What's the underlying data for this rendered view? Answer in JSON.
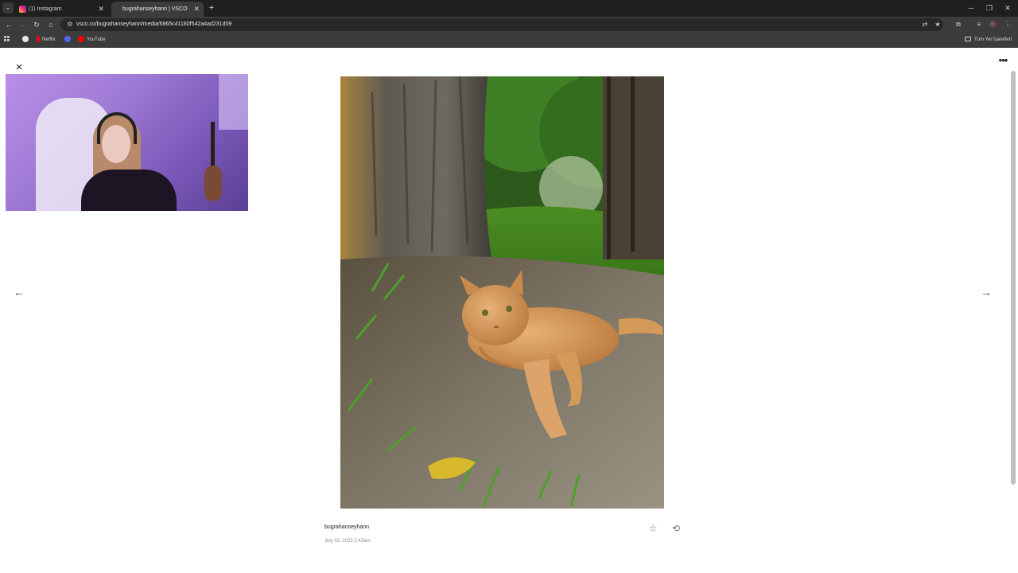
{
  "browser": {
    "tabs": [
      {
        "title": "(1) Instagram",
        "active": false
      },
      {
        "title": "bugrahanseyhann | VSCO",
        "active": true
      }
    ],
    "url": "vsco.co/bugrahanseyhann/media/6865c41180f542a4ad231d09",
    "bookmarks": [
      {
        "label": "Netflix",
        "color": "#e50914"
      },
      {
        "label": "",
        "color": "#5865f2"
      },
      {
        "label": "YouTube",
        "color": "#ff0000"
      }
    ],
    "all_bookmarks_label": "Tüm Yer İşaretleri"
  },
  "post": {
    "username": "bugrahanseyhann",
    "date": "July 03, 2025 2:43am",
    "photo_subject": "orange-tabby-cat-under-tree"
  },
  "colors": {
    "page_bg": "#ffffff",
    "chrome_dark": "#1f1f1f",
    "chrome_toolbar": "#3c3c3c"
  },
  "icons": {
    "close": "×",
    "more": "•••",
    "prev": "←",
    "next": "→",
    "favorite": "☆",
    "republish": "⟲"
  }
}
